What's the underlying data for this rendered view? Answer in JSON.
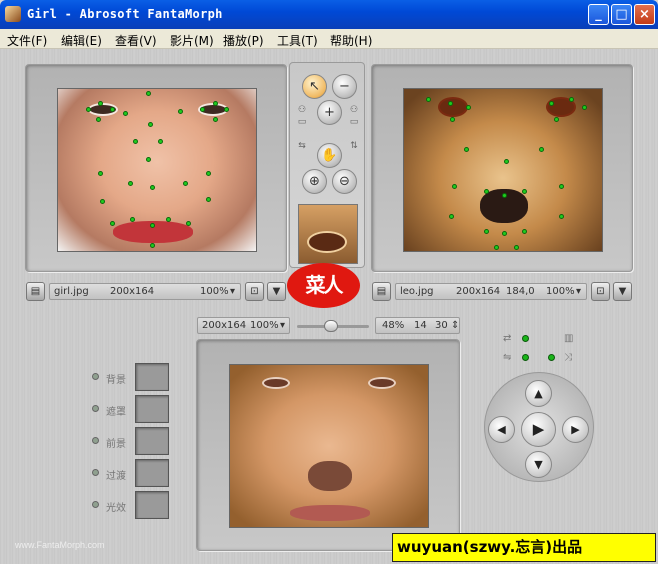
{
  "window": {
    "title": "Girl - Abrosoft FantaMorph",
    "min": "_",
    "max": "□",
    "close": "×"
  },
  "menu": [
    "文件(F)",
    "编辑(E)",
    "查看(V)",
    "影片(M)",
    "播放(P)",
    "工具(T)",
    "帮助(H)"
  ],
  "left_image": {
    "file": "girl.jpg",
    "size": "200x164",
    "zoom": "100%"
  },
  "right_image": {
    "file": "leo.jpg",
    "size": "200x164",
    "value": "184,0",
    "zoom": "100%"
  },
  "output": {
    "size": "200x164",
    "zoom": "100%",
    "percent": "48%",
    "frame": "14",
    "total": "30"
  },
  "slider": {
    "position": 0.46
  },
  "layers": [
    {
      "label": "背景"
    },
    {
      "label": "遮罩"
    },
    {
      "label": "前景"
    },
    {
      "label": "过渡"
    },
    {
      "label": "光效"
    }
  ],
  "seal_text": "菜人",
  "watermark": "www.FantaMorph.com",
  "credit": "wuyuan(szwy.忘言)出品",
  "colors": {
    "titlebar": "#0049d6",
    "keypoint": "#1fcc1f",
    "seal": "#e01810",
    "credit_bg": "#ffff00"
  }
}
